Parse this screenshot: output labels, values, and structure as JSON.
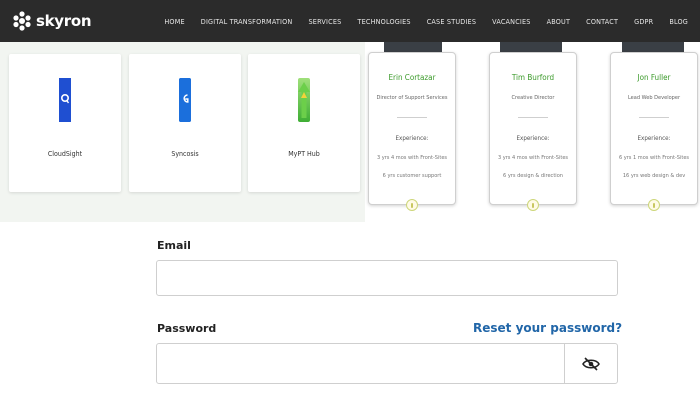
{
  "header": {
    "logo_text": "skyron",
    "nav": [
      "HOME",
      "DIGITAL TRANSFORMATION",
      "SERVICES",
      "TECHNOLOGIES",
      "CASE STUDIES",
      "VACANCIES",
      "ABOUT",
      "CONTACT",
      "GDPR",
      "BLOG"
    ]
  },
  "tools": [
    {
      "label": "CloudSight",
      "icon": "blue-q-icon",
      "color": "#1f4fd1"
    },
    {
      "label": "Syncosis",
      "icon": "blue-g-icon",
      "color": "#1b6fdc"
    },
    {
      "label": "MyPT Hub",
      "icon": "green-arrow-icon",
      "color": "#59c13d"
    }
  ],
  "team": [
    {
      "name": "Erin Cortazar",
      "role": "Director of Support Services",
      "exp_title": "Experience:",
      "exp1": "3 yrs 4 mos with Front-Sites",
      "exp2": "6 yrs customer support"
    },
    {
      "name": "Tim Burford",
      "role": "Creative Director",
      "exp_title": "Experience:",
      "exp1": "3 yrs 4 mos with Front-Sites",
      "exp2": "6 yrs design & direction"
    },
    {
      "name": "Jon Fuller",
      "role": "Lead Web Developer",
      "exp_title": "Experience:",
      "exp1": "6 yrs 1 mos with Front-Sites",
      "exp2": "16 yrs web design & dev"
    }
  ],
  "form": {
    "email_label": "Email",
    "email_value": "",
    "password_label": "Password",
    "password_value": "",
    "reset_link": "Reset your password?"
  }
}
